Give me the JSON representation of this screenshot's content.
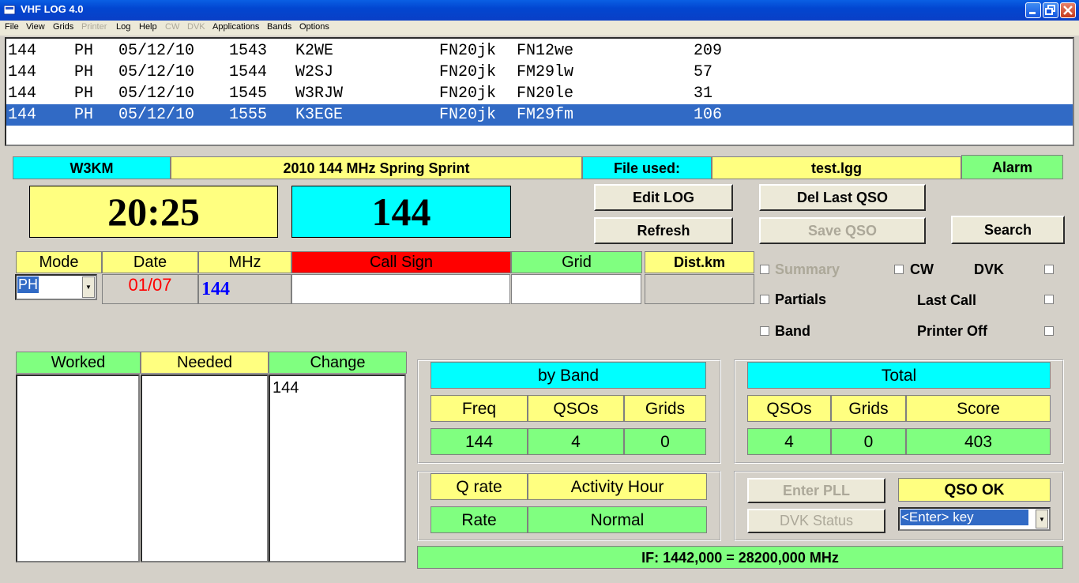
{
  "window": {
    "title": "VHF LOG    4.0"
  },
  "menu": [
    "File",
    "View",
    "Grids",
    "Printer",
    "Log",
    "Help",
    "CW",
    "DVK",
    "Applications",
    "Bands",
    "Options"
  ],
  "log_rows": [
    {
      "band": "144",
      "mode": "PH",
      "date": "05/12/10",
      "time": "1543",
      "call": "K2WE",
      "my_grid": "FN20jk",
      "grid": "FN12we",
      "dist": "209"
    },
    {
      "band": "144",
      "mode": "PH",
      "date": "05/12/10",
      "time": "1544",
      "call": "W2SJ",
      "my_grid": "FN20jk",
      "grid": "FM29lw",
      "dist": "57"
    },
    {
      "band": "144",
      "mode": "PH",
      "date": "05/12/10",
      "time": "1545",
      "call": "W3RJW",
      "my_grid": "FN20jk",
      "grid": "FN20le",
      "dist": "31"
    },
    {
      "band": "144",
      "mode": "PH",
      "date": "05/12/10",
      "time": "1555",
      "call": "K3EGE",
      "my_grid": "FN20jk",
      "grid": "FM29fm",
      "dist": "106"
    }
  ],
  "info": {
    "operator": "W3KM",
    "contest": "2010 144 MHz Spring Sprint",
    "file_label": "File used:",
    "file": "test.lgg",
    "alarm": "Alarm"
  },
  "clock": "20:25",
  "band_display": "144",
  "buttons": {
    "edit_log": "Edit LOG",
    "del_last": "Del Last QSO",
    "refresh": "Refresh",
    "save_qso": "Save QSO",
    "search": "Search",
    "enter_pll": "Enter PLL",
    "dvk_status": "DVK Status"
  },
  "entry": {
    "headers": {
      "mode": "Mode",
      "date": "Date",
      "mhz": "MHz",
      "call": "Call Sign",
      "grid": "Grid",
      "dist": "Dist.km"
    },
    "mode_value": "PH",
    "date_value": "01/07",
    "mhz_value": "144",
    "call_value": "",
    "grid_value": "",
    "dist_value": ""
  },
  "options": {
    "summary": "Summary",
    "cw": "CW",
    "dvk": "DVK",
    "partials": "Partials",
    "last_call": "Last Call",
    "band": "Band",
    "printer_off": "Printer Off"
  },
  "grids_table": {
    "worked": "Worked",
    "needed": "Needed",
    "change": "Change",
    "change_items": [
      "144"
    ]
  },
  "by_band": {
    "title": "by Band",
    "headers": [
      "Freq",
      "QSOs",
      "Grids"
    ],
    "row": [
      "144",
      "4",
      "0"
    ]
  },
  "total": {
    "title": "Total",
    "headers": [
      "QSOs",
      "Grids",
      "Score"
    ],
    "row": [
      "4",
      "0",
      "403"
    ]
  },
  "rate": {
    "q_rate": "Q rate",
    "activity_hour": "Activity Hour",
    "rate": "Rate",
    "normal": "Normal"
  },
  "qso_ok": {
    "label": "QSO OK",
    "select_value": "<Enter> key"
  },
  "if_line": "IF: 1442,000 = 28200,000 MHz",
  "colors": {
    "yellow": "#ffff80",
    "cyan": "#00ffff",
    "green": "#80ff80",
    "red": "#ff0000",
    "selection": "#316ac5"
  }
}
